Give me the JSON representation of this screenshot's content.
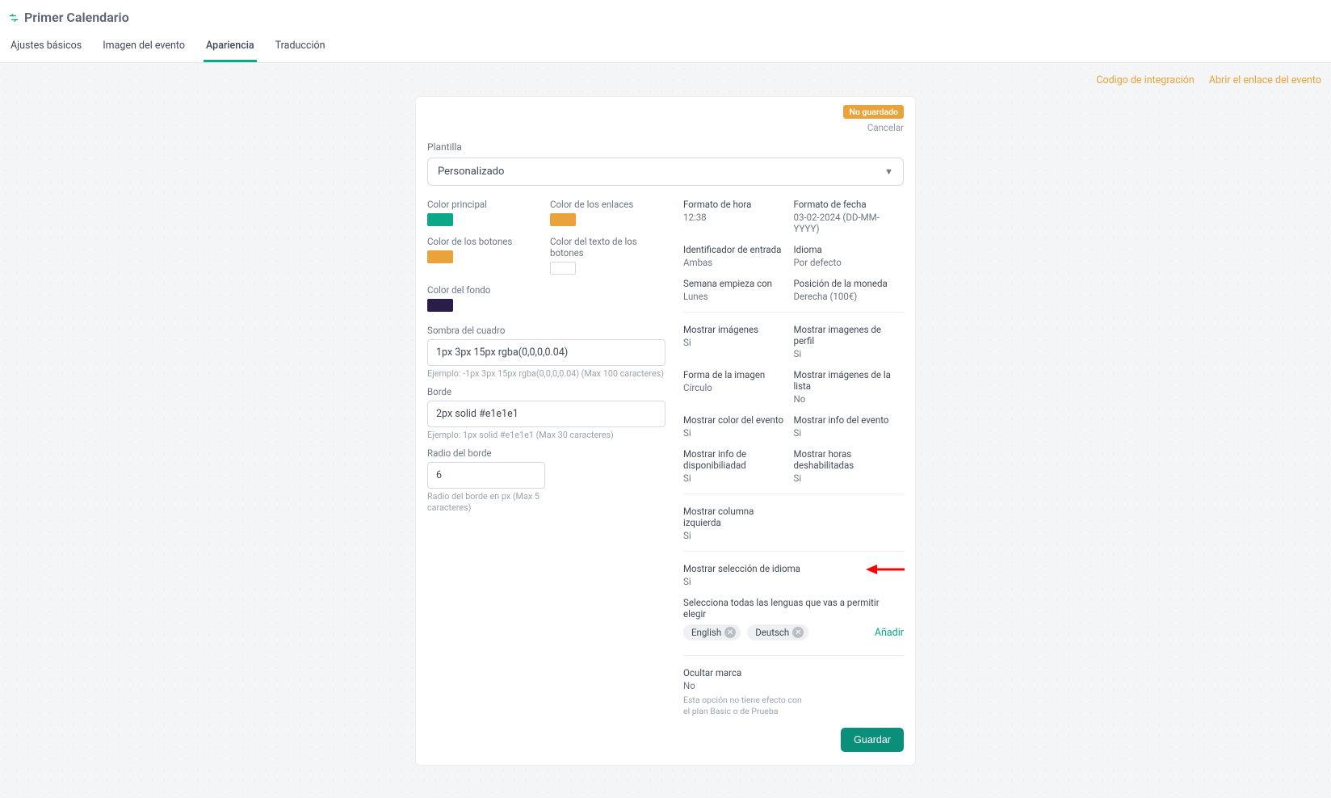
{
  "header": {
    "title": "Primer Calendario",
    "tabs": [
      {
        "label": "Ajustes básicos",
        "active": false
      },
      {
        "label": "Imagen del evento",
        "active": false
      },
      {
        "label": "Apariencia",
        "active": true
      },
      {
        "label": "Traducción",
        "active": false
      }
    ]
  },
  "topLinks": {
    "integration": "Codigo de integración",
    "openEvent": "Abrir el enlace del evento"
  },
  "card": {
    "badge": "No guardado",
    "cancel": "Cancelar",
    "templateLabel": "Plantilla",
    "templateValue": "Personalizado"
  },
  "colors": {
    "main": {
      "label": "Color principal",
      "value": "#0aa789"
    },
    "links": {
      "label": "Color de los enlaces",
      "value": "#e9a33a"
    },
    "buttons": {
      "label": "Color de los botones",
      "value": "#e9a33a"
    },
    "buttonText": {
      "label": "Color del texto de los botones",
      "value": "#ffffff"
    },
    "background": {
      "label": "Color del fondo",
      "value": "#2b1d4a"
    }
  },
  "boxShadow": {
    "label": "Sombra del cuadro",
    "value": "1px 3px 15px rgba(0,0,0,0.04)",
    "helper": "Ejemplo: -1px 3px 15px rgba(0,0,0,0.04) (Max 100 caracteres)"
  },
  "border": {
    "label": "Borde",
    "value": "2px solid #e1e1e1",
    "helper": "Ejemplo: 1px solid #e1e1e1 (Max 30 caracteres)"
  },
  "radius": {
    "label": "Radio del borde",
    "value": "6",
    "helper": "Radio del borde en px (Max 5 caracteres)"
  },
  "settings": {
    "timeFormat": {
      "label": "Formato de hora",
      "value": "12:38"
    },
    "dateFormat": {
      "label": "Formato de fecha",
      "value": "03-02-2024 (DD-MM-YYYY)"
    },
    "entryId": {
      "label": "Identificador de entrada",
      "value": "Ambas"
    },
    "language": {
      "label": "Idioma",
      "value": "Por defecto"
    },
    "weekStart": {
      "label": "Semana empieza con",
      "value": "Lunes"
    },
    "currencyPos": {
      "label": "Posición de la moneda",
      "value": "Derecha (100€)"
    },
    "showImages": {
      "label": "Mostrar imágenes",
      "value": "Si"
    },
    "showProfile": {
      "label": "Mostrar imagenes de perfil",
      "value": "Si"
    },
    "imageShape": {
      "label": "Forma de la imagen",
      "value": "Círculo"
    },
    "showListImg": {
      "label": "Mostrar imágenes de la lista",
      "value": "No"
    },
    "showEventColor": {
      "label": "Mostrar color del evento",
      "value": "Si"
    },
    "showEventInfo": {
      "label": "Mostrar info del evento",
      "value": "Si"
    },
    "showAvailInfo": {
      "label": "Mostrar info de disponibiliadad",
      "value": "Si"
    },
    "showDisabledHours": {
      "label": "Mostrar horas deshabilitadas",
      "value": "Si"
    },
    "showLeftCol": {
      "label": "Mostrar columna izquierda",
      "value": "Si"
    },
    "showLangSel": {
      "label": "Mostrar selección de idioma",
      "value": "Si"
    }
  },
  "langSection": {
    "prompt": "Selecciona todas las lenguas que vas a permitir elegir",
    "chips": [
      "English",
      "Deutsch"
    ],
    "add": "Añadir"
  },
  "hideBrand": {
    "label": "Ocultar marca",
    "value": "No",
    "hint": "Esta opción no tiene efecto con el plan Basic o de Prueba"
  },
  "saveBtn": "Guardar"
}
